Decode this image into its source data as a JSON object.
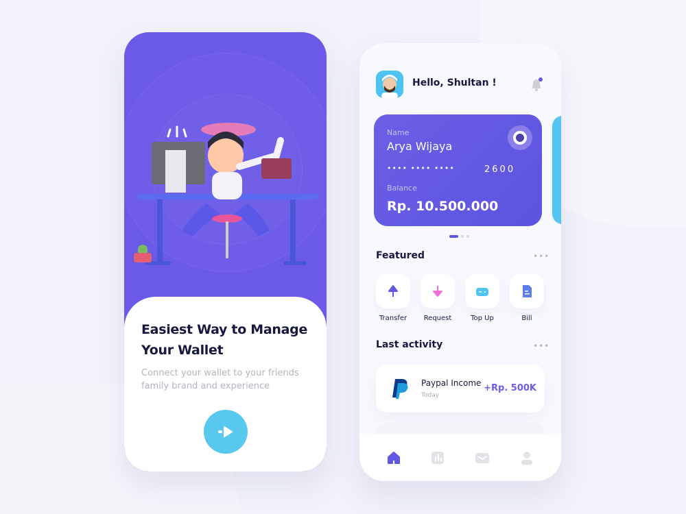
{
  "onboarding": {
    "title_line1": "Easiest Way to Manage",
    "title_line2": "Your Wallet",
    "subtitle_line1": "Connect your wallet to your friends",
    "subtitle_line2": "family brand and experience",
    "next_icon": "arrow-right-icon"
  },
  "home": {
    "greeting": "Hello, Shultan !",
    "card": {
      "name_label": "Name",
      "name": "Arya Wijaya",
      "masked": "••••   ••••   ••••",
      "last4": "2600",
      "balance_label": "Balance",
      "balance": "Rp. 10.500.000"
    },
    "featured": {
      "title": "Featured",
      "more": "•••",
      "items": [
        {
          "label": "Transfer",
          "color": "#6257e3"
        },
        {
          "label": "Request",
          "color": "#f26fd8"
        },
        {
          "label": "Top Up",
          "color": "#4fc3f2"
        },
        {
          "label": "Bill",
          "color": "#5b7ee8"
        }
      ]
    },
    "activity": {
      "title": "Last activity",
      "more": "•••",
      "items": [
        {
          "title": "Paypal Income",
          "date": "Today",
          "amount": "+Rp. 500K"
        }
      ]
    },
    "nav": [
      "home",
      "stats",
      "mail",
      "profile"
    ]
  },
  "colors": {
    "primary": "#6a5ae8",
    "accent": "#59c8ee",
    "text": "#15183f"
  }
}
